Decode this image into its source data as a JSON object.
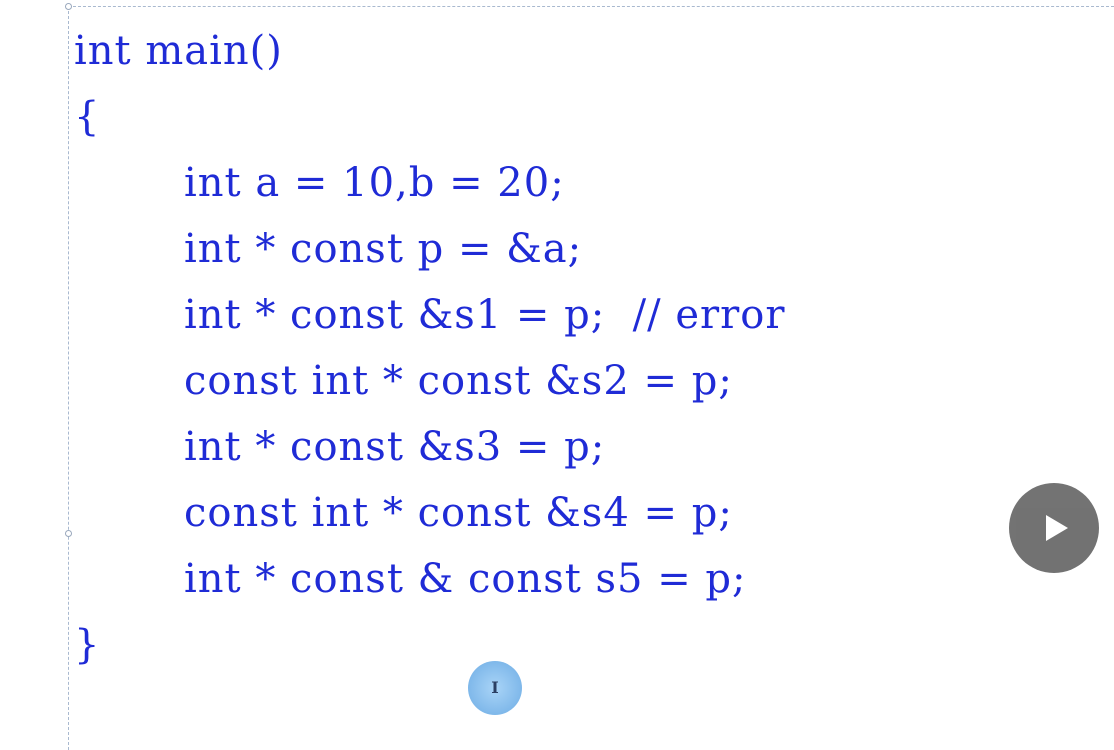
{
  "code": {
    "lines": [
      {
        "text": "int main()",
        "indent": false
      },
      {
        "text": "{",
        "indent": false
      },
      {
        "text": "int a = 10,b = 20;",
        "indent": true
      },
      {
        "text": "int * const p = &a;",
        "indent": true
      },
      {
        "text": "int * const &s1 = p;  // error",
        "indent": true
      },
      {
        "text": "const int * const &s2 = p;",
        "indent": true
      },
      {
        "text": "int * const &s3 = p;",
        "indent": true
      },
      {
        "text": "const int * const &s4 = p;",
        "indent": true
      },
      {
        "text": "int * const & const s5 = p;",
        "indent": true
      },
      {
        "text": "}",
        "indent": false
      }
    ]
  },
  "controls": {
    "play_icon": "play-triangle",
    "cursor_icon": "ibeam-cursor",
    "cursor_glyph": "I"
  },
  "colors": {
    "code_text": "#1f2bd6",
    "play_button_bg": "#6b6b6b",
    "cursor_highlight": "#7fb8ea"
  }
}
